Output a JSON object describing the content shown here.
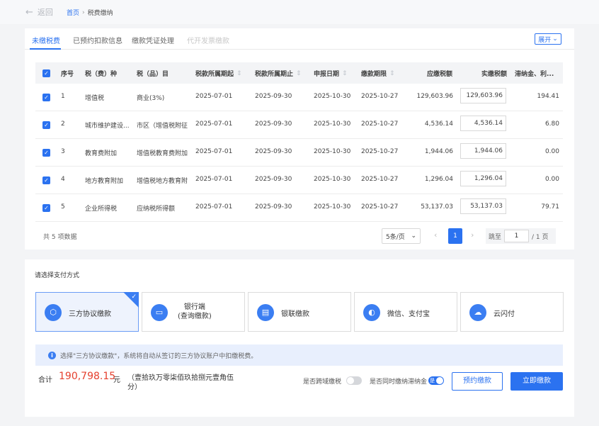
{
  "nav": {
    "back_label": "返回",
    "breadcrumb_home": "首页",
    "breadcrumb_sep": "›",
    "breadcrumb_current": "税费缴纳"
  },
  "tabs": [
    {
      "label": "未缴税费",
      "active": true
    },
    {
      "label": "已预约扣款信息"
    },
    {
      "label": "缴款凭证处理"
    },
    {
      "label": "代开发票缴款",
      "disabled": true
    }
  ],
  "expand_label": "展开",
  "table": {
    "headers": [
      "序号",
      "税（费）种",
      "税（品）目",
      "税款所属期起",
      "税款所属期止",
      "申报日期",
      "缴款期限",
      "应缴税额",
      "实缴税额",
      "滞纳金、利..."
    ],
    "rows": [
      {
        "no": "1",
        "tax": "增值税",
        "item": "商业(3%)",
        "start": "2025-07-01",
        "end": "2025-09-30",
        "filed": "2025-10-30",
        "due": "2025-10-27",
        "payable": "129,603.96",
        "actual": "129,603.96",
        "late": "194.41"
      },
      {
        "no": "2",
        "tax": "城市维护建设...",
        "item": "市区（增值税附征",
        "start": "2025-07-01",
        "end": "2025-09-30",
        "filed": "2025-10-30",
        "due": "2025-10-27",
        "payable": "4,536.14",
        "actual": "4,536.14",
        "late": "6.80"
      },
      {
        "no": "3",
        "tax": "教育费附加",
        "item": "增值税教育费附加",
        "start": "2025-07-01",
        "end": "2025-09-30",
        "filed": "2025-10-30",
        "due": "2025-10-27",
        "payable": "1,944.06",
        "actual": "1,944.06",
        "late": "0.00"
      },
      {
        "no": "4",
        "tax": "地方教育附加",
        "item": "增值税地方教育附",
        "start": "2025-07-01",
        "end": "2025-09-30",
        "filed": "2025-10-30",
        "due": "2025-10-27",
        "payable": "1,296.04",
        "actual": "1,296.04",
        "late": "0.00"
      },
      {
        "no": "5",
        "tax": "企业所得税",
        "item": "应纳税所得额",
        "start": "2025-07-01",
        "end": "2025-09-30",
        "filed": "2025-10-30",
        "due": "2025-10-27",
        "payable": "53,137.03",
        "actual": "53,137.03",
        "late": "79.71"
      }
    ]
  },
  "pagination": {
    "total_text": "共 5 项数据",
    "page_size": "5条/页",
    "current": "1",
    "jump_label": "跳至",
    "jump_value": "1",
    "total_pages": "/ 1 页"
  },
  "payment": {
    "title": "请选择支付方式",
    "methods": [
      {
        "label": "三方协议缴款",
        "selected": true
      },
      {
        "label": "银行端",
        "label2": "(查询缴款)"
      },
      {
        "label": "银联缴款"
      },
      {
        "label": "微信、支付宝"
      },
      {
        "label": "云闪付"
      }
    ],
    "notice": "选择\"三方协议缴款\"，系统将自动从签订的三方协议账户中扣缴税费。"
  },
  "summary": {
    "total_label": "合计",
    "total_amount": "190,798.15",
    "unit": "元",
    "amount_words": "（壹拾玖万零柒佰玖拾捌元壹角伍分）",
    "cross_region_label": "是否跨域缴税",
    "late_fee_label": "是否同时缴纳滞纳金",
    "cross_region_toggle": false,
    "late_fee_toggle": true,
    "toggle_on_text": "是",
    "reserve_button": "预约缴款",
    "pay_button": "立即缴款"
  },
  "colors": {
    "accent": "#2b72f0",
    "total_red": "#e5402e"
  }
}
